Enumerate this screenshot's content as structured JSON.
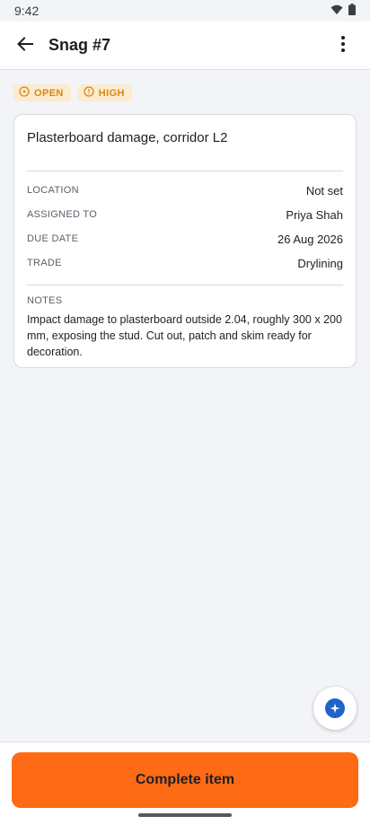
{
  "status_bar": {
    "time": "9:42"
  },
  "header": {
    "title": "Snag #7"
  },
  "badges": [
    {
      "label": "OPEN",
      "icon": "circle-dot-icon"
    },
    {
      "label": "HIGH",
      "icon": "alert-circle-icon"
    }
  ],
  "colors": {
    "accent": "#ff6a14",
    "badge_bg": "#fbebd0",
    "badge_text": "#d48a12",
    "fab": "#1e63c9"
  },
  "card": {
    "title": "Plasterboard damage, corridor L2",
    "rows": [
      {
        "label": "LOCATION",
        "value": "Not set"
      },
      {
        "label": "ASSIGNED TO",
        "value": "Priya Shah"
      },
      {
        "label": "DUE DATE",
        "value": "26 Aug 2026"
      },
      {
        "label": "TRADE",
        "value": "Drylining"
      }
    ],
    "notes_label": "NOTES",
    "notes": "Impact damage to plasterboard outside 2.04, roughly 300 x 200 mm, exposing the stud. Cut out, patch and skim ready for decoration."
  },
  "fab": {
    "icon": "sparkle-icon"
  },
  "footer": {
    "complete_label": "Complete item"
  }
}
